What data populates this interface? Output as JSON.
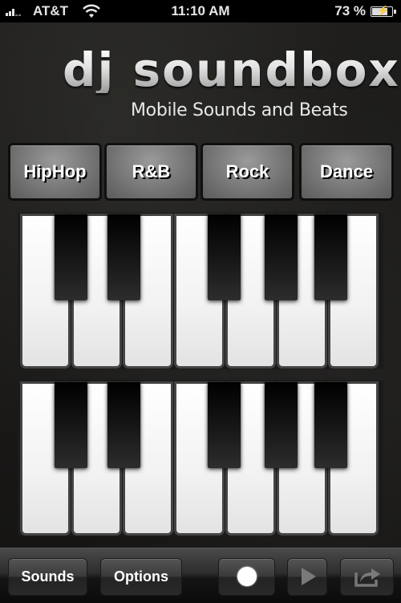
{
  "status_bar": {
    "carrier": "AT&T",
    "time": "11:10 AM",
    "battery_percent_label": "73 %",
    "battery_level": 0.73,
    "signal_bars": 3,
    "signal_icon": "signal-bars-icon",
    "wifi_icon": "wifi-icon",
    "battery_icon": "battery-charging-icon"
  },
  "header": {
    "logo_text": "dj soundbox",
    "tagline": "Mobile Sounds and Beats"
  },
  "genres": [
    {
      "label": "HipHop"
    },
    {
      "label": "R&B"
    },
    {
      "label": "Rock"
    },
    {
      "label": "Dance"
    }
  ],
  "keyboards": [
    {
      "name": "upper-keyboard",
      "white_keys": 7,
      "black_keys": 5
    },
    {
      "name": "lower-keyboard",
      "white_keys": 7,
      "black_keys": 5
    }
  ],
  "toolbar": {
    "sounds_label": "Sounds",
    "options_label": "Options",
    "record_icon": "record-icon",
    "play_icon": "play-icon",
    "share_icon": "share-icon"
  }
}
